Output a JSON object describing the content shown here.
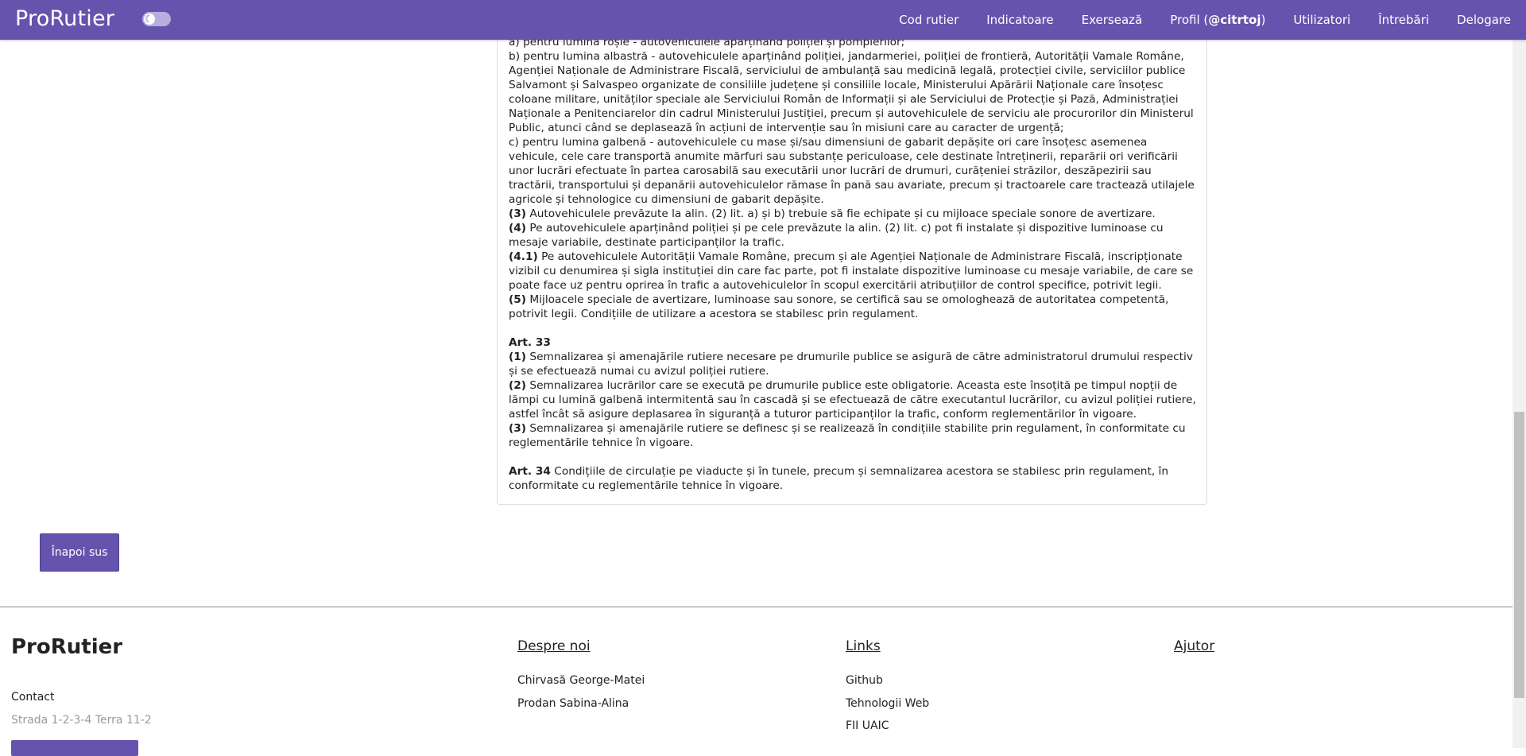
{
  "navbar": {
    "brand": "ProRutier",
    "links": [
      {
        "label": "Cod rutier"
      },
      {
        "label": "Indicatoare"
      },
      {
        "label": "Exersează"
      },
      {
        "label_prefix": "Profil (",
        "label_bold": "@citrtoj",
        "label_suffix": ")"
      },
      {
        "label": "Utilizatori"
      },
      {
        "label": "Întrebări"
      },
      {
        "label": "Delogare"
      }
    ],
    "theme_toggle_icon": "moon-icon"
  },
  "law": {
    "lines_top": [
      "a) pentru lumina roșie - autovehiculele aparținând poliției și pompierilor;",
      "b) pentru lumina albastră - autovehiculele aparținând poliției, jandarmeriei, poliției de frontieră, Autorității Vamale Române, Agenției Naționale de Administrare Fiscală, serviciului de ambulanță sau medicină legală, protecției civile, serviciilor publice Salvamont și Salvaspeo organizate de consiliile județene și consiliile locale, Ministerului Apărării Naționale care însoțesc coloane militare, unităților speciale ale Serviciului Român de Informații și ale Serviciului de Protecție și Pază, Administrației Naționale a Penitenciarelor din cadrul Ministerului Justiției, precum și autovehiculele de serviciu ale procurorilor din Ministerul Public, atunci când se deplasează în acțiuni de intervenție sau în misiuni care au caracter de urgență;",
      "c) pentru lumina galbenă - autovehiculele cu mase și/sau dimensiuni de gabarit depășite ori care însoțesc asemenea vehicule, cele care transportă anumite mărfuri sau substanțe periculoase, cele destinate întreținerii, reparării ori verificării unor lucrări efectuate în partea carosabilă sau executării unor lucrări de drumuri, curățeniei străzilor, deszăpezirii sau tractării, transportului și depanării autovehiculelor rămase în pană sau avariate, precum și tractoarele care tractează utilajele agricole și tehnologice cu dimensiuni de gabarit depășite."
    ],
    "art32_paragraphs": [
      {
        "num": "(3)",
        "text": " Autovehiculele prevăzute la alin. (2) lit. a) și b) trebuie să fie echipate și cu mijloace speciale sonore de avertizare."
      },
      {
        "num": "(4)",
        "text": " Pe autovehiculele aparținând poliției și pe cele prevăzute la alin. (2) lit. c) pot fi instalate și dispozitive luminoase cu mesaje variabile, destinate participanților la trafic."
      },
      {
        "num": "(4.1)",
        "text": " Pe autovehiculele Autorității Vamale Române, precum și ale Agenției Naționale de Administrare Fiscală, inscripționate vizibil cu denumirea și sigla instituției din care fac parte, pot fi instalate dispozitive luminoase cu mesaje variabile, de care se poate face uz pentru oprirea în trafic a autovehiculelor în scopul exercitării atribuțiilor de control specifice, potrivit legii."
      },
      {
        "num": "(5)",
        "text": " Mijloacele speciale de avertizare, luminoase sau sonore, se certifică sau se omologhează de autoritatea competentă, potrivit legii. Condițiile de utilizare a acestora se stabilesc prin regulament."
      }
    ],
    "art33_title": "Art. 33",
    "art33_paragraphs": [
      {
        "num": "(1)",
        "text": " Semnalizarea și amenajările rutiere necesare pe drumurile publice se asigură de către administratorul drumului respectiv și se efectuează numai cu avizul poliției rutiere."
      },
      {
        "num": "(2)",
        "text": " Semnalizarea lucrărilor care se execută pe drumurile publice este obligatorie. Aceasta este însoțită pe timpul nopții de lămpi cu lumină galbenă intermitentă sau în cascadă și se efectuează de către executantul lucrărilor, cu avizul poliției rutiere, astfel încât să asigure deplasarea în siguranță a tuturor participanților la trafic, conform reglementărilor în vigoare."
      },
      {
        "num": "(3)",
        "text": " Semnalizarea și amenajările rutiere se definesc și se realizează în condițiile stabilite prin regulament, în conformitate cu reglementările tehnice în vigoare."
      }
    ],
    "art34_title": "Art. 34",
    "art34_text": " Condițiile de circulație pe viaducte și în tunele, precum și semnalizarea acestora se stabilesc prin regulament, în conformitate cu reglementările tehnice în vigoare."
  },
  "back_button": "Înapoi sus",
  "footer": {
    "brand": "ProRutier",
    "contact_label": "Contact",
    "contact_value": "Strada 1-2-3-4 Terra 11-2",
    "columns": [
      {
        "heading": "Despre noi",
        "items": [
          "Chirvasă George-Matei",
          "Prodan Sabina-Alina"
        ]
      },
      {
        "heading": "Links",
        "items": [
          "Github",
          "Tehnologii Web",
          "FII UAIC"
        ]
      },
      {
        "heading": "Ajutor",
        "items": []
      }
    ]
  },
  "colors": {
    "accent": "#6553ad"
  }
}
